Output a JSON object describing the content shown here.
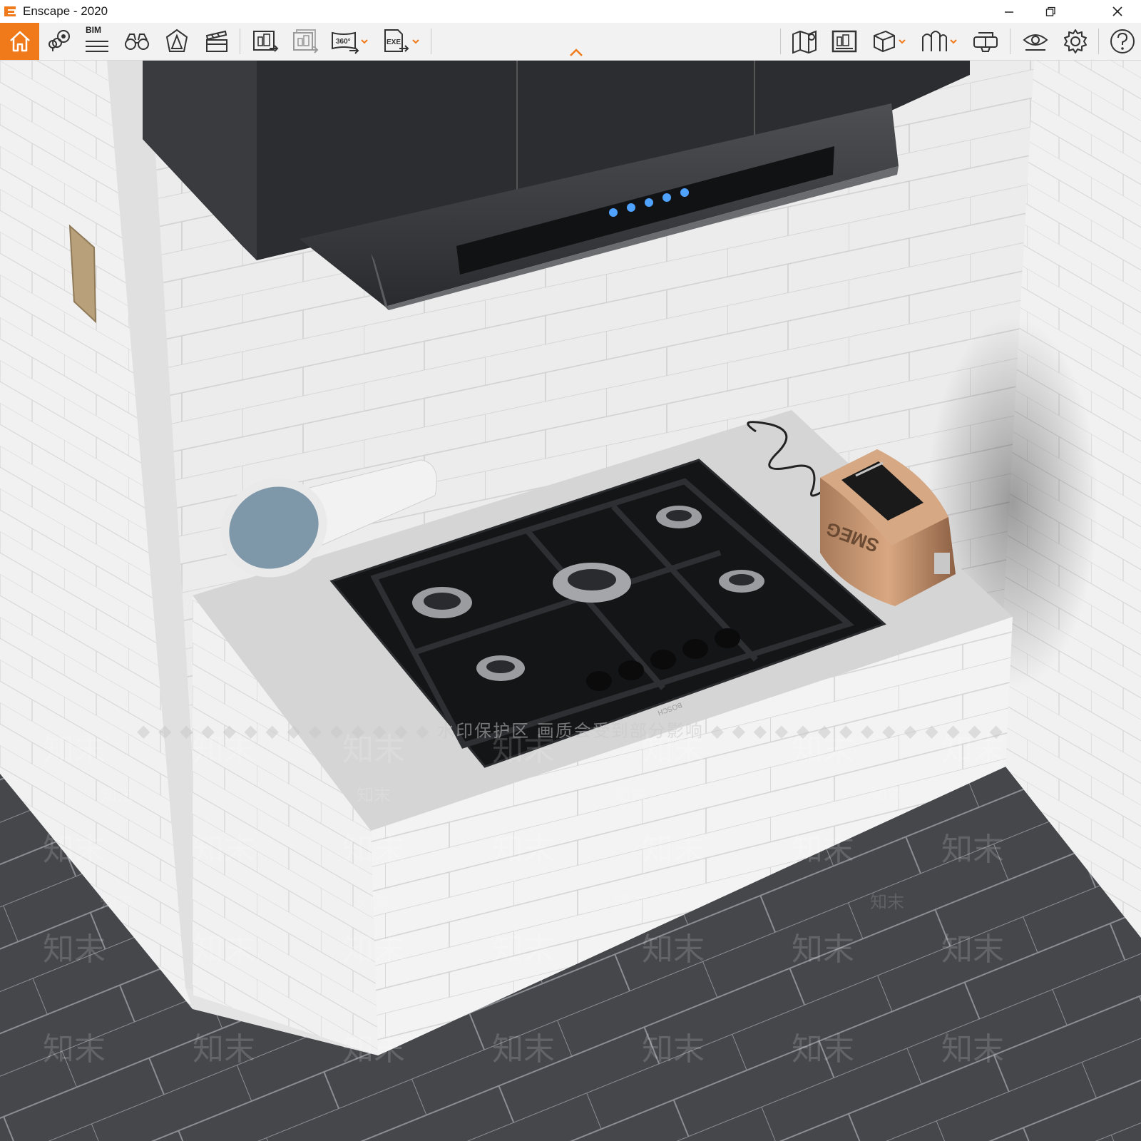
{
  "window": {
    "title": "Enscape - 2020",
    "minimize": "—",
    "restore": "❐",
    "close": "✕"
  },
  "toolbar": {
    "bim_label": "BIM",
    "collapse_icon": "chevron-up-icon",
    "accent": "#f07a1a",
    "buttons": [
      {
        "name": "home-button",
        "icon": "home-icon"
      },
      {
        "name": "view-management-button",
        "icon": "location-pin-icon"
      },
      {
        "name": "bim-info-button",
        "icon": "bim-list-icon"
      },
      {
        "name": "visual-settings-button",
        "icon": "binoculars-icon"
      },
      {
        "name": "asset-library-button",
        "icon": "asset-shape-icon"
      },
      {
        "name": "video-editor-button",
        "icon": "clapper-icon"
      },
      {
        "name": "render-image-button",
        "icon": "render-image-icon"
      },
      {
        "name": "batch-render-button",
        "icon": "batch-render-icon"
      },
      {
        "name": "render-panorama-button",
        "icon": "panorama-360-icon"
      },
      {
        "name": "export-exe-button",
        "icon": "export-exe-icon"
      },
      {
        "name": "map-button",
        "icon": "map-icon"
      },
      {
        "name": "capture-manager-button",
        "icon": "gallery-icon"
      },
      {
        "name": "cube-button",
        "icon": "cube-icon"
      },
      {
        "name": "section-button",
        "icon": "section-icon"
      },
      {
        "name": "vr-headset-button",
        "icon": "vr-headset-icon"
      },
      {
        "name": "view-mode-button",
        "icon": "eye-icon"
      },
      {
        "name": "settings-button",
        "icon": "gear-icon"
      },
      {
        "name": "help-button",
        "icon": "help-icon"
      }
    ],
    "exe_label": "EXE",
    "pano_label": "360°"
  },
  "viewport": {
    "watermark_line": "◆ ◆ ◆ ◆ ◆ ◆ ◆ ◆ ◆ ◆ ◆ ◆ ◆ ◆ 水印保护区  画质会受到部分影响 ◆ ◆ ◆ ◆ ◆ ◆ ◆ ◆ ◆ ◆ ◆ ◆ ◆ ◆",
    "watermark_text": "知末",
    "hob_brand": "BOSCH",
    "toaster_brand": "SMEG"
  }
}
